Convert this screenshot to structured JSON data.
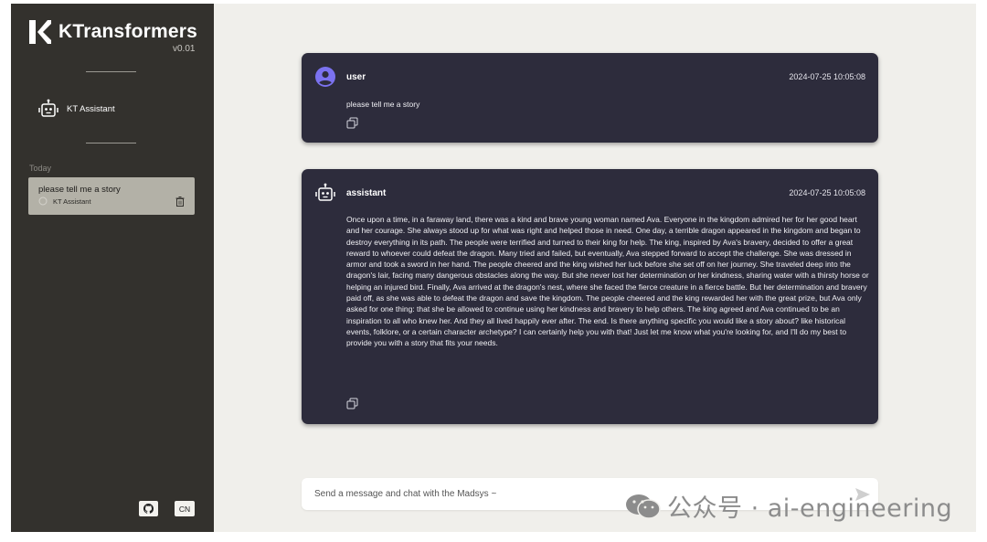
{
  "app": {
    "name": "KTransformers",
    "version": "v0.01"
  },
  "sidebar": {
    "assistant_label": "KT Assistant",
    "section_label": "Today",
    "history": [
      {
        "title": "please tell me a story",
        "assistant": "KT Assistant"
      }
    ],
    "footer": {
      "github_icon": "github-icon",
      "lang_label": "CN"
    }
  },
  "messages": [
    {
      "role": "user",
      "timestamp": "2024-07-25 10:05:08",
      "text": "please tell me a story"
    },
    {
      "role": "assistant",
      "timestamp": "2024-07-25 10:05:08",
      "text": "Once upon a time, in a faraway land, there was a kind and brave young woman named Ava. Everyone in the kingdom admired her for her good heart and her courage. She always stood up for what was right and helped those in need. One day, a terrible dragon appeared in the kingdom and began to destroy everything in its path. The people were terrified and turned to their king for help. The king, inspired by Ava's bravery, decided to offer a great reward to whoever could defeat the dragon. Many tried and failed, but eventually, Ava stepped forward to accept the challenge. She was dressed in armor and took a sword in her hand. The people cheered and the king wished her luck before she set off on her journey. She traveled deep into the dragon's lair, facing many dangerous obstacles along the way. But she never lost her determination or her kindness, sharing water with a thirsty horse or helping an injured bird. Finally, Ava arrived at the dragon's nest, where she faced the fierce creature in a fierce battle. But her determination and bravery paid off, as she was able to defeat the dragon and save the kingdom. The people cheered and the king rewarded her with the great prize, but Ava only asked for one thing: that she be allowed to continue using her kindness and bravery to help others. The king agreed and Ava continued to be an inspiration to all who knew her. And they all lived happily ever after. The end. Is there anything specific you would like a story about? like historical events, folklore, or a certain character archetype? I can certainly help you with that! Just let me know what you're looking for, and I'll do my best to provide you with a story that fits your needs."
    }
  ],
  "input": {
    "placeholder": "Send a message and chat with the Madsys ~"
  },
  "watermark": {
    "text": "公众号 · ai-engineering"
  },
  "colors": {
    "sidebar_bg": "#33312d",
    "main_bg": "#f0efeb",
    "message_bg": "#2d2c3c",
    "user_avatar": "#7b72f0",
    "history_item_bg": "#b3b1a7"
  }
}
